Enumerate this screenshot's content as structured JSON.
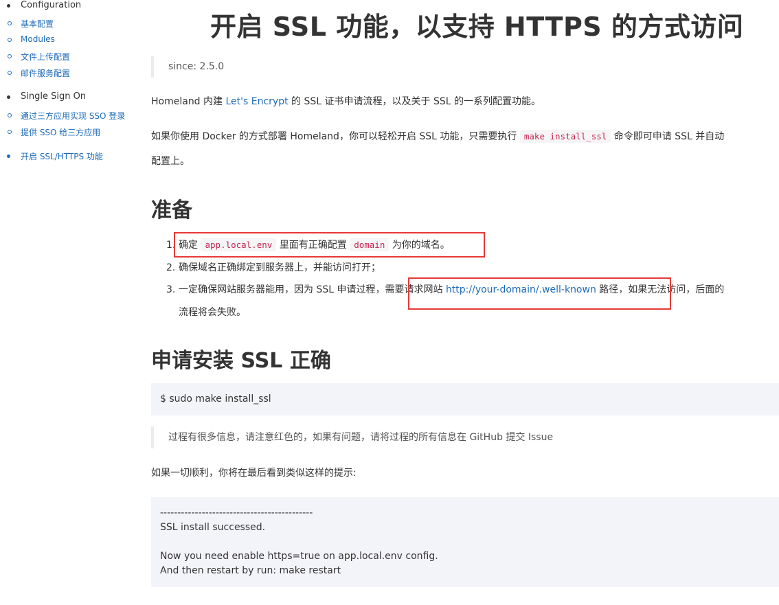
{
  "sidebar": {
    "section_configuration": "Configuration",
    "config_items": [
      "基本配置",
      "Modules",
      "文件上传配置",
      "邮件服务配置"
    ],
    "section_sso": "Single Sign On",
    "sso_items": [
      "通过三方应用实现 SSO 登录",
      "提供 SSO 给三方应用"
    ],
    "section_ssl": "开启 SSL/HTTPS 功能"
  },
  "main": {
    "title": "开启 SSL 功能，以支持 HTTPS 的方式访问",
    "since": "since: 2.5.0",
    "intro": {
      "prefix": "Homeland 内建 ",
      "link": "Let's Encrypt",
      "suffix": " 的 SSL 证书申请流程，以及关于 SSL 的一系列配置功能。"
    },
    "docker": {
      "prefix": "如果你使用 Docker 的方式部署 Homeland，你可以轻松开启 SSL 功能，只需要执行 ",
      "code": "make install_ssl",
      "suffix": " 命令即可申请 SSL 并自动",
      "line2": "配置上。"
    },
    "prepare_heading": "准备",
    "prepare_items": {
      "item1": {
        "num": "1.",
        "prefix": "确定 ",
        "code1": "app.local.env",
        "middle": " 里面有正确配置 ",
        "code2": "domain",
        "suffix": " 为你的域名。"
      },
      "item2": {
        "num": "2.",
        "text": "确保域名正确绑定到服务器上，并能访问打开；"
      },
      "item3": {
        "num": "3.",
        "prefix": "一定确保网站服务器能用，因为 SSL 申请过程，需要请求网站 ",
        "link": "http://your-domain/.well-known",
        "suffix": " 路径，如果无法访问，后面的",
        "line2": "流程将会失败。"
      }
    },
    "install_heading": "申请安装 SSL 正确",
    "install_command": "$ sudo make install_ssl",
    "install_note": "过程有很多信息，请注意红色的，如果有问题，请将过程的所有信息在 GitHub 提交 Issue",
    "success_intro": "如果一切顺利，你将在最后看到类似这样的提示:",
    "output_lines": [
      "--------------------------------------------",
      "SSL install successed.",
      "",
      "Now you need enable https=true on app.local.env config.",
      "And then restart by run: make restart"
    ]
  },
  "colors": {
    "link": "#1e6bb8",
    "code_text": "#c7254e",
    "highlight_box": "#e53935",
    "code_block_bg": "#f3f3fa"
  }
}
